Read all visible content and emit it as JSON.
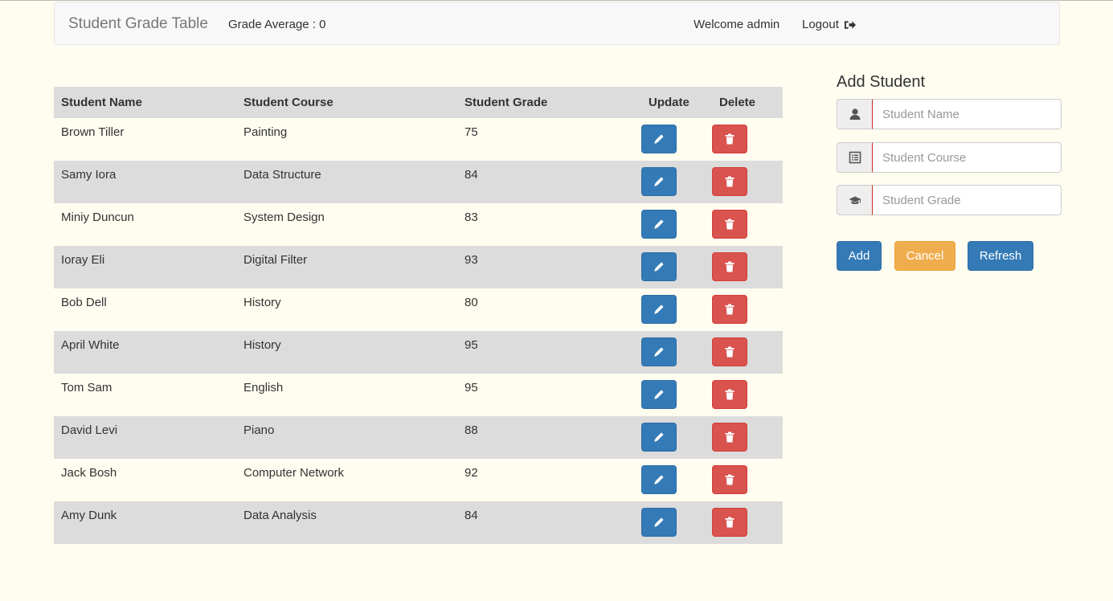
{
  "navbar": {
    "brand": "Student Grade Table",
    "grade_average": "Grade Average : 0",
    "welcome": "Welcome admin",
    "logout": "Logout"
  },
  "table": {
    "headers": [
      "Student Name",
      "Student Course",
      "Student Grade",
      "Update",
      "Delete"
    ],
    "rows": [
      {
        "name": "Brown Tiller",
        "course": "Painting",
        "grade": "75"
      },
      {
        "name": "Samy Iora",
        "course": "Data Structure",
        "grade": "84"
      },
      {
        "name": "Miniy Duncun",
        "course": "System Design",
        "grade": "83"
      },
      {
        "name": "Ioray Eli",
        "course": "Digital Filter",
        "grade": "93"
      },
      {
        "name": "Bob Dell",
        "course": "History",
        "grade": "80"
      },
      {
        "name": "April White",
        "course": "History",
        "grade": "95"
      },
      {
        "name": "Tom Sam",
        "course": "English",
        "grade": "95"
      },
      {
        "name": "David Levi",
        "course": "Piano",
        "grade": "88"
      },
      {
        "name": "Jack Bosh",
        "course": "Computer Network",
        "grade": "92"
      },
      {
        "name": "Amy Dunk",
        "course": "Data Analysis",
        "grade": "84"
      }
    ]
  },
  "form": {
    "title": "Add Student",
    "name_placeholder": "Student Name",
    "course_placeholder": "Student Course",
    "grade_placeholder": "Student Grade",
    "name_icon": "user-icon",
    "course_icon": "list-alt-icon",
    "grade_icon": "education-icon",
    "add_label": "Add",
    "cancel_label": "Cancel",
    "refresh_label": "Refresh"
  },
  "icons": {
    "update": "pencil-icon",
    "delete": "trash-icon",
    "logout": "log-out-icon"
  },
  "colors": {
    "background": "#fffdf0",
    "primary": "#337ab7",
    "danger": "#d9534f",
    "warning": "#f0ad4e",
    "stripe": "#dcdcdc"
  }
}
